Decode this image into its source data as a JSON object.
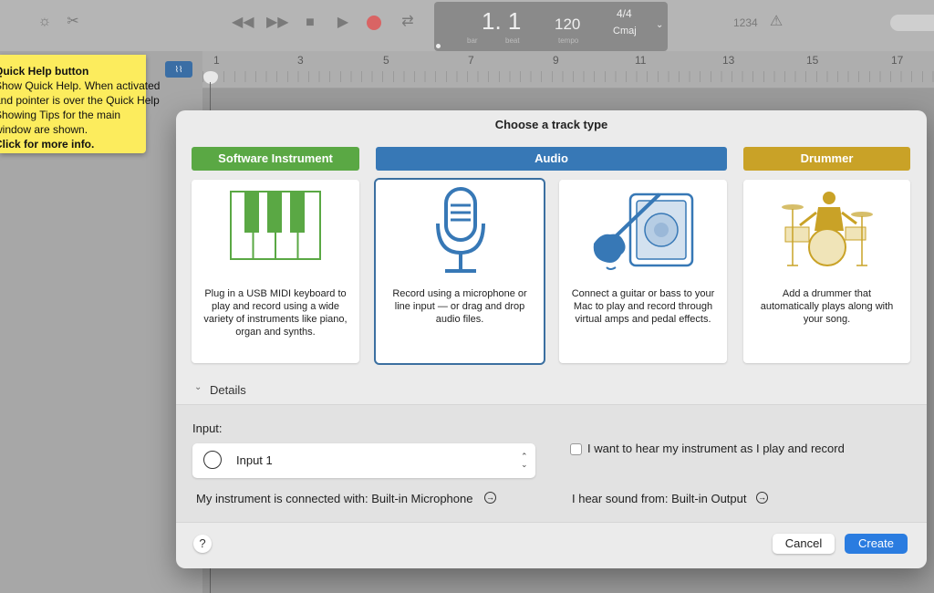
{
  "toolbar": {
    "icons": [
      "metronome-icon",
      "scissors-icon",
      "rewind-icon",
      "fast-forward-icon",
      "stop-icon",
      "play-icon",
      "record-icon",
      "cycle-icon",
      "tuning-fork-icon"
    ],
    "lcd": {
      "position_value": "1. 1",
      "bar_label": "bar",
      "beat_label": "beat",
      "tempo_value": "120",
      "tempo_label": "tempo",
      "time_signature": "4/4",
      "key": "Cmaj"
    },
    "count_in": "1234"
  },
  "ruler": {
    "ticks": [
      "1",
      "3",
      "5",
      "7",
      "9",
      "11",
      "13",
      "15",
      "17"
    ]
  },
  "tooltip": {
    "lines": [
      "Quick Help button",
      "Show Quick Help. When activated",
      "and pointer is over the Quick Help",
      "Showing Tips for the main",
      "window are shown.",
      "Click for more info."
    ]
  },
  "dialog": {
    "title": "Choose a track type",
    "categories": [
      {
        "label": "Software Instrument",
        "color": "#5aa844"
      },
      {
        "label": "Audio",
        "color": "#3778b6"
      },
      {
        "label": "Drummer",
        "color": "#c9a227"
      }
    ],
    "cards": [
      {
        "icon": "piano-keyboard-icon",
        "description": "Plug in a USB MIDI keyboard to play and record using a wide variety of instruments like piano, organ and synths."
      },
      {
        "icon": "microphone-icon",
        "description": "Record using a microphone or line input — or drag and drop audio files."
      },
      {
        "icon": "guitar-amp-icon",
        "description": "Connect a guitar or bass to your Mac to play and record through virtual amps and pedal effects."
      },
      {
        "icon": "drummer-icon",
        "description": "Add a drummer that automatically plays along with your song."
      }
    ],
    "details_label": "Details",
    "input_label": "Input:",
    "input_value": "Input 1",
    "hear_checkbox_label": "I want to hear my instrument as I play and record",
    "connected_label": "My instrument is connected with: Built-in Microphone",
    "hear_from_label": "I hear sound from: Built-in Output",
    "help_label": "?",
    "cancel_label": "Cancel",
    "create_label": "Create",
    "accent_color": "#2a7ce0"
  }
}
